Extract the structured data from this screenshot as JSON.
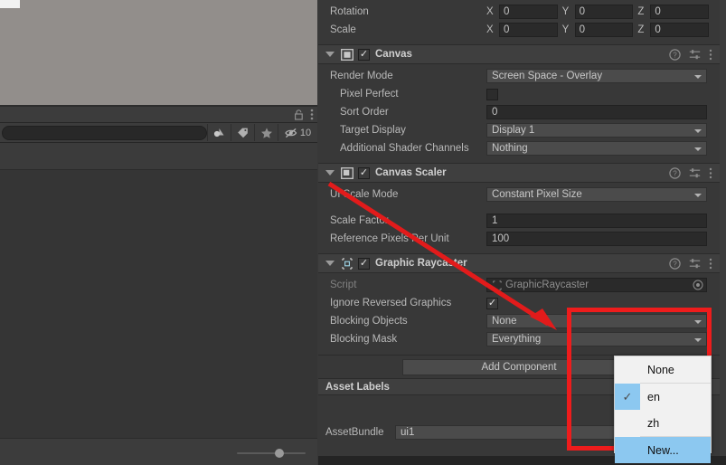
{
  "app": "unity-editor-inspector",
  "left_panel": {
    "viewport": {
      "name": "scene-viewport",
      "color": "#928e8b"
    },
    "toolbar": {
      "search_placeholder": "",
      "search_value": "",
      "icons": [
        {
          "name": "filter-by-type-icon",
          "glyph": "type"
        },
        {
          "name": "filter-by-label-icon",
          "glyph": "tag"
        },
        {
          "name": "favorite-star-icon",
          "glyph": "star"
        },
        {
          "name": "hidden-packages-icon",
          "glyph": "eye-off"
        }
      ],
      "hidden_count": "10"
    },
    "header_icons": [
      {
        "name": "lock-icon",
        "glyph": "lock"
      },
      {
        "name": "kebab-menu-icon",
        "glyph": "kebab"
      }
    ],
    "footer": {
      "zoom_slider_name": "thumbnail-size-slider",
      "zoom_value": 55
    }
  },
  "inspector": {
    "transform": {
      "rows": [
        {
          "label": "Rotation",
          "x": "0",
          "y": "0",
          "z": "0"
        },
        {
          "label": "Scale",
          "x": "0",
          "y": "0",
          "z": "0"
        }
      ],
      "axis_labels": {
        "x": "X",
        "y": "Y",
        "z": "Z"
      }
    },
    "components": [
      {
        "name": "canvas",
        "title": "Canvas",
        "enabled": true,
        "icon": "canvas-icon",
        "header_icons": [
          "help-icon",
          "preset-icon",
          "kebab-menu-icon"
        ],
        "properties": [
          {
            "kind": "popup",
            "label": "Render Mode",
            "value": "Screen Space - Overlay",
            "indent": false
          },
          {
            "kind": "checkbox",
            "label": "Pixel Perfect",
            "value": false,
            "indent": true
          },
          {
            "kind": "field",
            "label": "Sort Order",
            "value": "0",
            "indent": true
          },
          {
            "kind": "popup",
            "label": "Target Display",
            "value": "Display 1",
            "indent": true
          },
          {
            "kind": "popup",
            "label": "Additional Shader Channels",
            "value": "Nothing",
            "indent": true
          }
        ]
      },
      {
        "name": "canvas-scaler",
        "title": "Canvas Scaler",
        "enabled": true,
        "icon": "canvas-scaler-icon",
        "header_icons": [
          "help-icon",
          "preset-icon",
          "kebab-menu-icon"
        ],
        "properties": [
          {
            "kind": "popup",
            "label": "UI Scale Mode",
            "value": "Constant Pixel Size",
            "indent": false
          },
          {
            "kind": "spacer"
          },
          {
            "kind": "field",
            "label": "Scale Factor",
            "value": "1",
            "indent": false
          },
          {
            "kind": "field",
            "label": "Reference Pixels Per Unit",
            "value": "100",
            "indent": false
          }
        ]
      },
      {
        "name": "graphic-raycaster",
        "title": "Graphic Raycaster",
        "enabled": true,
        "icon": "graphic-raycaster-icon",
        "header_icons": [
          "help-icon",
          "preset-icon",
          "kebab-menu-icon"
        ],
        "properties": [
          {
            "kind": "object",
            "label": "Script",
            "value": "GraphicRaycaster",
            "dim": true
          },
          {
            "kind": "checkbox",
            "label": "Ignore Reversed Graphics",
            "value": true
          },
          {
            "kind": "popup",
            "label": "Blocking Objects",
            "value": "None"
          },
          {
            "kind": "popup",
            "label": "Blocking Mask",
            "value": "Everything"
          }
        ]
      }
    ],
    "add_component_label": "Add Component",
    "asset_labels_title": "Asset Labels",
    "asset_bundle": {
      "label": "AssetBundle",
      "value": "ui1",
      "variant_value": ""
    }
  },
  "dropdown": {
    "name": "assetbundle-variant-dropdown",
    "items": [
      {
        "label": "None",
        "checked": false,
        "selected": false,
        "separator_below": true
      },
      {
        "label": "en",
        "checked": true,
        "selected": false
      },
      {
        "label": "zh",
        "checked": false,
        "selected": false,
        "separator_below": true
      },
      {
        "label": "New...",
        "checked": false,
        "selected": true
      }
    ]
  },
  "annotations": {
    "highlight_box": {
      "name": "red-highlight-box",
      "color": "#ee1c1c"
    },
    "arrow": {
      "name": "red-arrow-annotation",
      "color": "#e21b1b"
    }
  }
}
